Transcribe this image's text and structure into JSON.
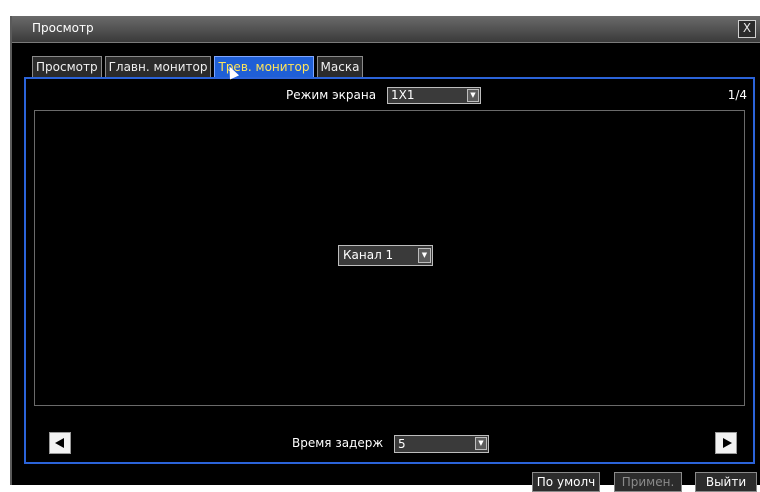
{
  "window": {
    "title": "Просмотр",
    "close_symbol": "X"
  },
  "tabs": [
    {
      "label": "Просмотр",
      "active": false
    },
    {
      "label": "Главн. монитор",
      "active": false
    },
    {
      "label": "Трев. монитор",
      "active": true
    },
    {
      "label": "Маска",
      "active": false
    }
  ],
  "screen_mode": {
    "label": "Режим экрана",
    "value": "1X1"
  },
  "page_indicator": "1/4",
  "channel_select": {
    "value": "Канал 1"
  },
  "delay": {
    "label": "Время задерж",
    "value": "5"
  },
  "buttons": {
    "default": "По умолч",
    "apply": "Примен.",
    "exit": "Выйти"
  },
  "colors": {
    "accent_blue": "#2b63d9",
    "active_tab_text": "#ffe45a",
    "background": "#000000"
  },
  "icons": {
    "prev": "prev-arrow-icon",
    "next": "next-arrow-icon",
    "dropdown": "chevron-down-icon"
  }
}
